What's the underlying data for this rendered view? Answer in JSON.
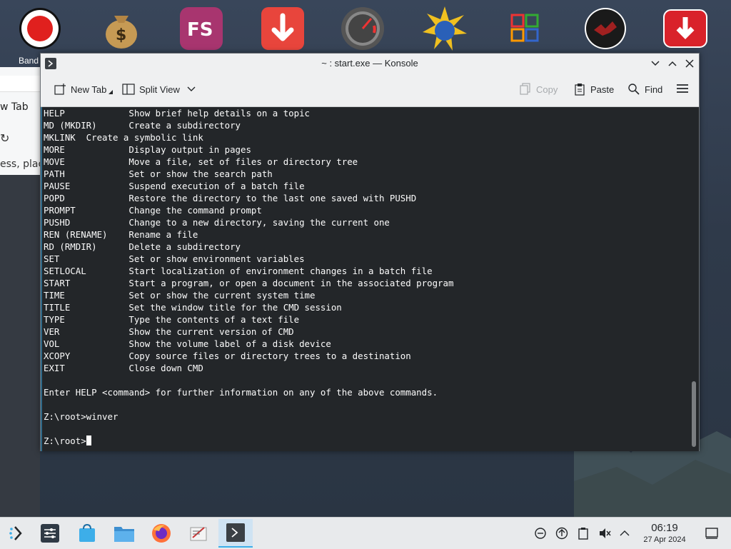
{
  "desktop": {
    "dock_label": "Band"
  },
  "background_app": {
    "tab_text": "w Tab",
    "address_text": "ess, plac"
  },
  "window": {
    "title": "~ : start.exe — Konsole"
  },
  "toolbar": {
    "new_tab": "New Tab",
    "split_view": "Split View",
    "copy": "Copy",
    "paste": "Paste",
    "find": "Find"
  },
  "terminal": {
    "lines": [
      "HELP            Show brief help details on a topic",
      "MD (MKDIR)      Create a subdirectory",
      "MKLINK  Create a symbolic link",
      "MORE            Display output in pages",
      "MOVE            Move a file, set of files or directory tree",
      "PATH            Set or show the search path",
      "PAUSE           Suspend execution of a batch file",
      "POPD            Restore the directory to the last one saved with PUSHD",
      "PROMPT          Change the command prompt",
      "PUSHD           Change to a new directory, saving the current one",
      "REN (RENAME)    Rename a file",
      "RD (RMDIR)      Delete a subdirectory",
      "SET             Set or show environment variables",
      "SETLOCAL        Start localization of environment changes in a batch file",
      "START           Start a program, or open a document in the associated program",
      "TIME            Set or show the current system time",
      "TITLE           Set the window title for the CMD session",
      "TYPE            Type the contents of a text file",
      "VER             Show the current version of CMD",
      "VOL             Show the volume label of a disk device",
      "XCOPY           Copy source files or directory trees to a destination",
      "EXIT            Close down CMD",
      "",
      "Enter HELP <command> for further information on any of the above commands.",
      "",
      "Z:\\root>winver",
      ""
    ],
    "prompt": "Z:\\root>"
  },
  "taskbar": {
    "time": "06:19",
    "date": "27 Apr 2024"
  }
}
